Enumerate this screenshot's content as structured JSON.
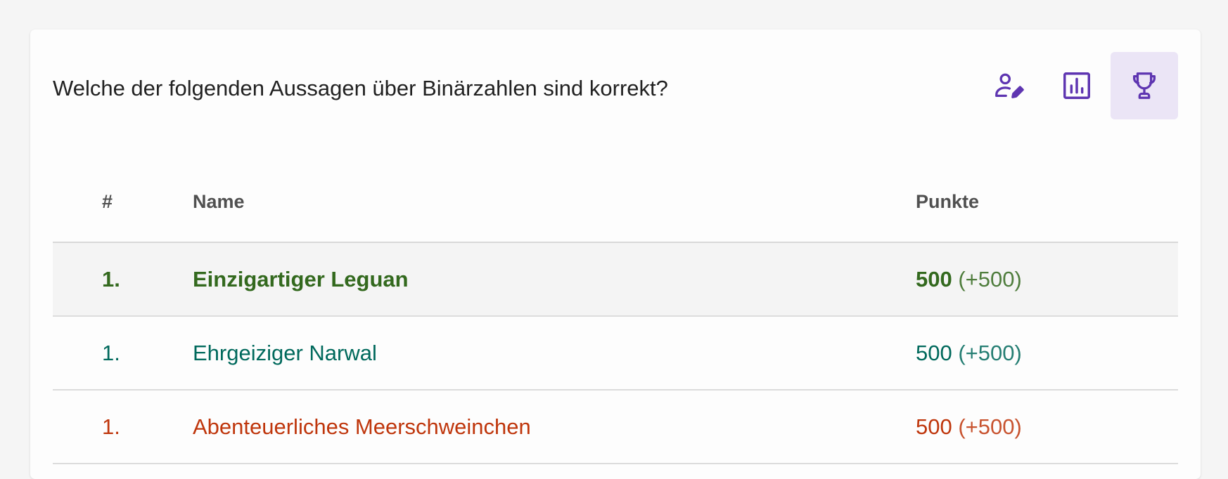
{
  "question": "Welche der folgenden Aussagen über Binärzahlen sind korrekt?",
  "toolbar": {
    "items": [
      {
        "icon": "person-edit-icon",
        "active": false
      },
      {
        "icon": "bar-chart-icon",
        "active": false
      },
      {
        "icon": "trophy-icon",
        "active": true
      }
    ],
    "accent_color": "#5e35b1"
  },
  "table": {
    "headers": {
      "rank": "#",
      "name": "Name",
      "points": "Punkte"
    },
    "rows": [
      {
        "rank": "1.",
        "name": "Einzigartiger Leguan",
        "points": "500",
        "delta": "(+500)",
        "color": "#33691e",
        "highlight": true
      },
      {
        "rank": "1.",
        "name": "Ehrgeiziger Narwal",
        "points": "500",
        "delta": "(+500)",
        "color": "#00695c",
        "highlight": false
      },
      {
        "rank": "1.",
        "name": "Abenteuerliches Meerschweinchen",
        "points": "500",
        "delta": "(+500)",
        "color": "#bf360c",
        "highlight": false
      }
    ]
  }
}
